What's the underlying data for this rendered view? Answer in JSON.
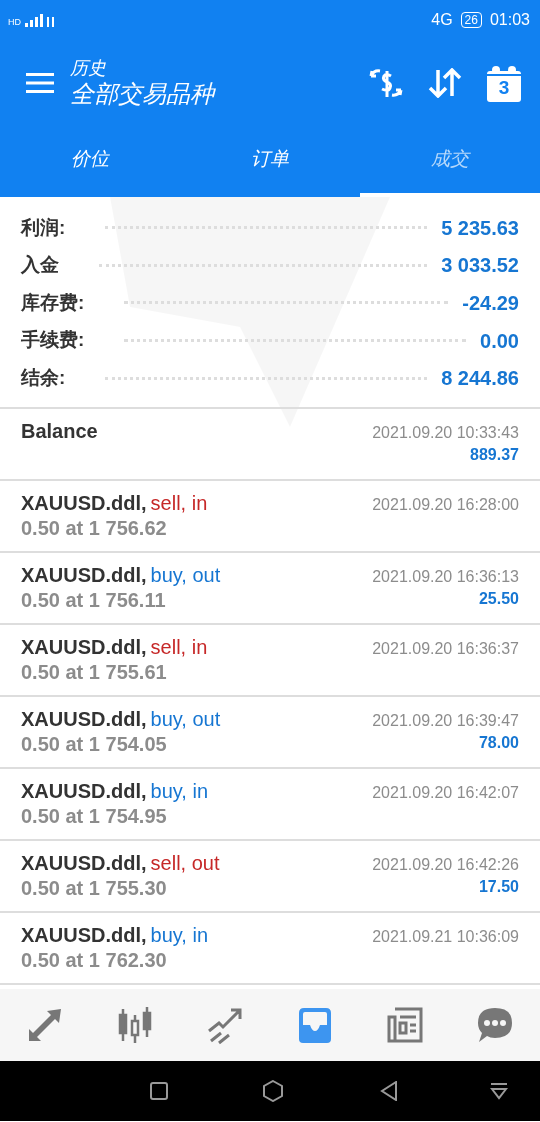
{
  "status_bar": {
    "signal": "HD",
    "network": "4G",
    "battery": "26",
    "time": "01:03"
  },
  "header": {
    "subtitle": "历史",
    "title": "全部交易品种",
    "calendar_day": "3"
  },
  "tabs": [
    {
      "label": "价位",
      "selected": false
    },
    {
      "label": "订单",
      "selected": false
    },
    {
      "label": "成交",
      "selected": true
    }
  ],
  "summary": [
    {
      "label": "利润:",
      "value": "5 235.63"
    },
    {
      "label": "入金",
      "value": "3 033.52"
    },
    {
      "label": "库存费:",
      "value": "-24.29"
    },
    {
      "label": "手续费:",
      "value": "0.00"
    },
    {
      "label": "结余:",
      "value": "8 244.86"
    }
  ],
  "deals": [
    {
      "kind": "balance",
      "symbol": "Balance",
      "time": "2021.09.20 10:33:43",
      "profit": "889.37"
    },
    {
      "kind": "trade",
      "symbol": "XAUUSD.ddl,",
      "action": "sell, in",
      "color": "#c62828",
      "detail": "0.50 at 1 756.62",
      "time": "2021.09.20 16:28:00"
    },
    {
      "kind": "trade",
      "symbol": "XAUUSD.ddl,",
      "action": "buy, out",
      "color": "#1676d2",
      "detail": "0.50 at 1 756.11",
      "time": "2021.09.20 16:36:13",
      "profit": "25.50"
    },
    {
      "kind": "trade",
      "symbol": "XAUUSD.ddl,",
      "action": "sell, in",
      "color": "#c62828",
      "detail": "0.50 at 1 755.61",
      "time": "2021.09.20 16:36:37"
    },
    {
      "kind": "trade",
      "symbol": "XAUUSD.ddl,",
      "action": "buy, out",
      "color": "#1676d2",
      "detail": "0.50 at 1 754.05",
      "time": "2021.09.20 16:39:47",
      "profit": "78.00"
    },
    {
      "kind": "trade",
      "symbol": "XAUUSD.ddl,",
      "action": "buy, in",
      "color": "#1676d2",
      "detail": "0.50 at 1 754.95",
      "time": "2021.09.20 16:42:07"
    },
    {
      "kind": "trade",
      "symbol": "XAUUSD.ddl,",
      "action": "sell, out",
      "color": "#c62828",
      "detail": "0.50 at 1 755.30",
      "time": "2021.09.20 16:42:26",
      "profit": "17.50"
    },
    {
      "kind": "trade",
      "symbol": "XAUUSD.ddl,",
      "action": "buy, in",
      "color": "#1676d2",
      "detail": "0.50 at 1 762.30",
      "time": "2021.09.21 10:36:09"
    }
  ],
  "bottom_nav": [
    {
      "kind": "quotes",
      "selected": false
    },
    {
      "kind": "chart",
      "selected": false
    },
    {
      "kind": "trade",
      "selected": false
    },
    {
      "kind": "history",
      "selected": true
    },
    {
      "kind": "news",
      "selected": false
    },
    {
      "kind": "chat",
      "selected": false
    }
  ]
}
